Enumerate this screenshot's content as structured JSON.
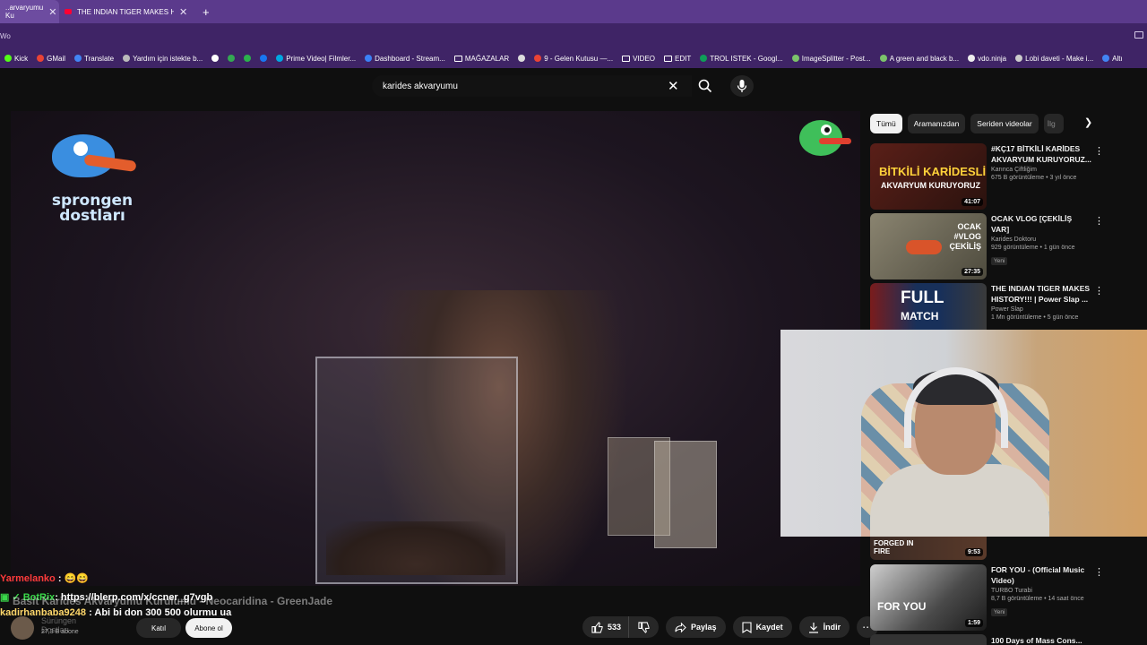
{
  "browser": {
    "tabs": [
      {
        "label": "..arvaryumu Ku",
        "active": true
      },
      {
        "label": "THE INDIAN TIGER MAKES HIST",
        "active": false
      }
    ],
    "address_text": "Wo",
    "bookmarks": [
      {
        "label": "Kick",
        "icon": "kick-icon"
      },
      {
        "label": "GMail",
        "icon": "gmail-icon"
      },
      {
        "label": "Translate",
        "icon": "translate-icon"
      },
      {
        "label": "Yardım için istekte b...",
        "icon": "globe-icon"
      },
      {
        "label": "",
        "icon": "x-icon"
      },
      {
        "label": "",
        "icon": "chrome-icon"
      },
      {
        "label": "",
        "icon": "feedly-icon"
      },
      {
        "label": "",
        "icon": "facebook-icon"
      },
      {
        "label": "Prime Video| Filmler...",
        "icon": "prime-icon"
      },
      {
        "label": "Dashboard - Stream...",
        "icon": "stream-icon"
      },
      {
        "label": "MAĞAZALAR",
        "icon": "folder-icon"
      },
      {
        "label": "",
        "icon": "circle-icon"
      },
      {
        "label": "9 - Gelen Kutusu —...",
        "icon": "gmail-icon"
      },
      {
        "label": "VIDEO",
        "icon": "folder-icon"
      },
      {
        "label": "EDIT",
        "icon": "folder-icon"
      },
      {
        "label": "TROL ISTEK - Googl...",
        "icon": "sheets-icon"
      },
      {
        "label": "ImageSplitter - Post...",
        "icon": "image-icon"
      },
      {
        "label": "A green and black b...",
        "icon": "image-icon"
      },
      {
        "label": "vdo.ninja",
        "icon": "ninja-icon"
      },
      {
        "label": "Lobi daveti - Make i...",
        "icon": "lobby-icon"
      },
      {
        "label": "Altı",
        "icon": "doc-icon"
      }
    ]
  },
  "search": {
    "query": "karides akvaryumu"
  },
  "video": {
    "logo_text": "sprongen dostları",
    "title_ghost": "Basit Karides Akvaryumu Kurulumu - Neocaridina - GreenJade",
    "channel": "Sürüngen Dostları",
    "subs": "27,3 B abone",
    "join_label": "Katıl",
    "subscribe_label": "Abone ol",
    "likes": "533",
    "share_label": "Paylaş",
    "save_label": "Kaydet",
    "download_label": "İndir"
  },
  "chat": [
    {
      "user": "Yarmelanko",
      "text": ": 😄😄"
    },
    {
      "user": "BotRix",
      "text": ": https://blerp.com/x/ccner_g7vgb"
    },
    {
      "user": "kadirhanbaba9248",
      "text": ": Abi bi don 300 500 olurmu ua"
    }
  ],
  "chips": [
    "Tümü",
    "Aramanızdan",
    "Seriden videolar",
    "İlg"
  ],
  "recommendations": [
    {
      "title": "#KÇ17 BİTKİLİ KARİDES AKVARYUM KURUYORUZ...",
      "channel": "Karınca Çiftliğim",
      "meta": "675 B görüntüleme • 3 yıl önce",
      "duration": "41:07",
      "badge": "",
      "thumb_color": "#3b1f1a"
    },
    {
      "title": "OCAK VLOG [ÇEKİLİŞ VAR]",
      "channel": "Karides Doktoru",
      "meta": "929 görüntüleme • 1 gün önce",
      "duration": "27:35",
      "badge": "Yeni",
      "thumb_color": "#6b6a58"
    },
    {
      "title": "THE INDIAN TIGER MAKES HISTORY!!! | Power Slap ...",
      "channel": "Power Slap",
      "meta": "1 Mn görüntüleme • 5 gün önce",
      "duration": "",
      "badge": "",
      "thumb_color": "#18305a"
    },
    {
      "title": "FOR YOU - (Official Music Video)",
      "channel": "TURBO Turabi",
      "meta": "8,7 B görüntüleme • 14 saat önce",
      "duration": "1:59",
      "badge": "Yeni",
      "thumb_color": "#2a2a2a"
    }
  ],
  "partial_rec": {
    "duration": "9:53",
    "thumb_text": "FORGED IN FIRE",
    "scroll_title": "100 Days of Mass Cons..."
  },
  "colors": {
    "tab_bar": "#5b3a8c",
    "toolbar": "#3f2466",
    "yt_red": "#ff0033",
    "bg": "#0f0f0f"
  }
}
